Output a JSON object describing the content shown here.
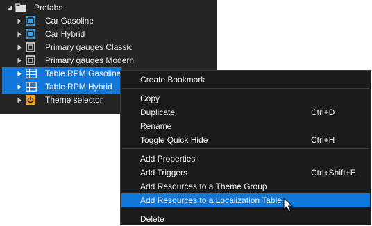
{
  "colors": {
    "panel_bg": "#252526",
    "selection": "#1177d8",
    "menu_bg": "#1b1b1c",
    "icon_blue": "#3aa0e8",
    "icon_orange": "#f0a020"
  },
  "tree": {
    "root": {
      "label": "Prefabs",
      "icon": "folder-icon"
    },
    "items": [
      {
        "label": "Car Gasoline",
        "icon": "prefab-blue-icon",
        "selected": false
      },
      {
        "label": "Car Hybrid",
        "icon": "prefab-blue-icon",
        "selected": false
      },
      {
        "label": "Primary gauges Classic",
        "icon": "prefab-white-icon",
        "selected": false
      },
      {
        "label": "Primary gauges Modern",
        "icon": "prefab-white-icon",
        "selected": false
      },
      {
        "label": "Table RPM Gasoline",
        "icon": "table-icon",
        "selected": true
      },
      {
        "label": "Table RPM Hybrid",
        "icon": "table-icon",
        "selected": true
      },
      {
        "label": "Theme selector",
        "icon": "power-icon",
        "selected": false
      }
    ]
  },
  "context_menu": {
    "items": [
      {
        "label": "Create Bookmark",
        "shortcut": ""
      },
      {
        "label": "Copy",
        "shortcut": ""
      },
      {
        "label": "Duplicate",
        "shortcut": "Ctrl+D"
      },
      {
        "label": "Rename",
        "shortcut": ""
      },
      {
        "label": "Toggle Quick Hide",
        "shortcut": "Ctrl+H"
      },
      {
        "label": "Add Properties",
        "shortcut": ""
      },
      {
        "label": "Add Triggers",
        "shortcut": "Ctrl+Shift+E"
      },
      {
        "label": "Add Resources to a Theme Group",
        "shortcut": ""
      },
      {
        "label": "Add Resources to a Localization Table",
        "shortcut": "",
        "highlighted": true
      },
      {
        "label": "Delete",
        "shortcut": ""
      }
    ]
  }
}
